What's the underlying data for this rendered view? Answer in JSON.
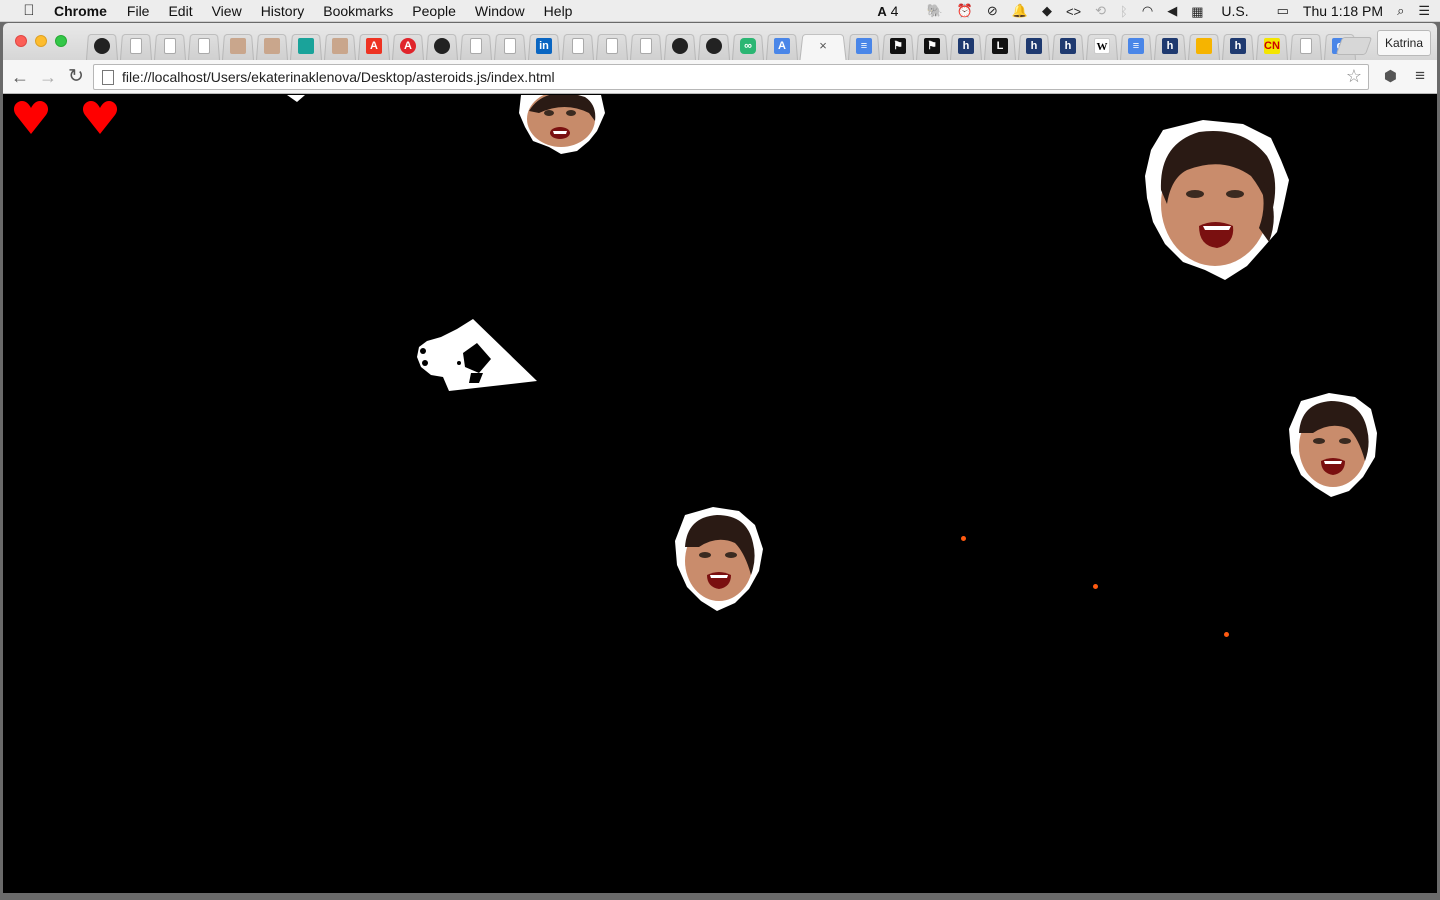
{
  "menubar": {
    "app_name": "Chrome",
    "items": [
      "File",
      "Edit",
      "View",
      "History",
      "Bookmarks",
      "People",
      "Window",
      "Help"
    ],
    "status": {
      "adobe_badge": "4",
      "input_source": "U.S.",
      "clock": "Thu 1:18 PM"
    }
  },
  "browser": {
    "url": "file://localhost/Users/ekaterinaklenova/Desktop/asteroids.js/index.html",
    "profile_name": "Katrina",
    "active_tab_close": "×",
    "tab_favicons": [
      "github-icon",
      "doc-icon",
      "doc-icon",
      "doc-icon",
      "person-icon",
      "person-icon",
      "teal-icon",
      "person-icon",
      "adobe-icon",
      "acrobat-icon",
      "github-icon",
      "doc-icon",
      "doc-icon",
      "linkedin-icon",
      "doc-icon",
      "doc-icon",
      "doc-icon",
      "github-icon",
      "github-icon",
      "infinity-icon",
      "translate-icon",
      "active",
      "gdocs-icon",
      "flag-icon",
      "flag-icon",
      "h-icon",
      "l-icon",
      "h-icon",
      "h-icon",
      "wikipedia-icon",
      "gdocs-icon",
      "h-icon",
      "box-icon",
      "h-icon",
      "cn-icon",
      "doc-icon",
      "google-icon"
    ]
  },
  "game": {
    "background": "#000000",
    "lives": 2,
    "life_color": "#ff0000",
    "bullet_color": "#ff5a10",
    "ship_color": "#ffffff",
    "asteroid_count": 5,
    "bullet_count": 3
  }
}
